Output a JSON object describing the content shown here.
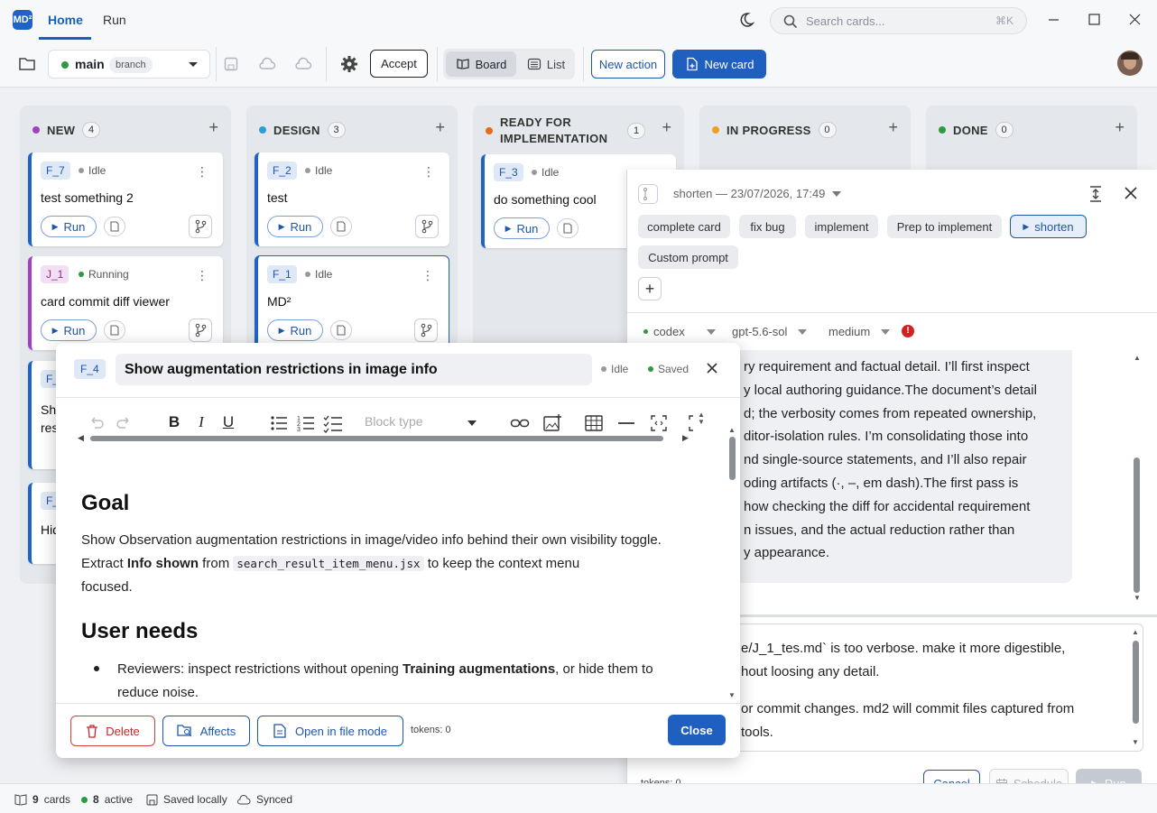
{
  "app": {
    "logo_text": "MD²",
    "tabs": [
      "Home",
      "Run"
    ],
    "active_tab": "Home",
    "search_placeholder": "Search cards...",
    "search_shortcut": "⌘K"
  },
  "toolbar": {
    "branch": "main",
    "branch_badge": "branch",
    "accept_label": "Accept",
    "board_label": "Board",
    "list_label": "List",
    "new_action_label": "New action",
    "new_card_label": "New card"
  },
  "columns": [
    {
      "title": "NEW",
      "count": "4",
      "color": "#a040c0"
    },
    {
      "title": "DESIGN",
      "count": "3",
      "color": "#2aa0d8"
    },
    {
      "title": "READY FOR IMPLEMENTATION",
      "title_line1": "READY FOR",
      "title_line2": "IMPLEMENTATION",
      "count": "1",
      "color": "#e86a1c"
    },
    {
      "title": "IN PROGRESS",
      "count": "0",
      "color": "#f0a020"
    },
    {
      "title": "DONE",
      "count": "0",
      "color": "#2e9a40"
    }
  ],
  "cards": [
    {
      "id": "F_7",
      "status": "Idle",
      "title": "test something 2",
      "run": "Run"
    },
    {
      "id": "J_1",
      "status": "Running",
      "title": "card commit diff viewer",
      "run": "Run"
    },
    {
      "id": "F_2",
      "status": "Idle",
      "title": "test",
      "run": "Run"
    },
    {
      "id": "F_1",
      "status": "Idle",
      "title": "MD²",
      "run": "Run"
    },
    {
      "id": "F_3",
      "status": "Idle",
      "title": "do something cool",
      "run": "Run"
    },
    {
      "id_partial": "F_",
      "title_partial": "Sh",
      "title_partial2": "res"
    },
    {
      "id_partial": "F_",
      "title_partial": "Hid"
    }
  ],
  "run_panel": {
    "header": "shorten — 23/07/2026, 17:49",
    "actions": [
      "complete card",
      "fix bug",
      "implement",
      "Prep to implement",
      "shorten",
      "Custom prompt"
    ],
    "model_agent": "codex",
    "model": "gpt-5.6-sol",
    "effort": "medium",
    "log_lines": [
      "ry requirement and factual detail. I’ll first inspect",
      "y local authoring guidance.The document’s detail",
      "d; the verbosity comes from repeated ownership,",
      "ditor-isolation rules. I’m consolidating those into",
      "nd single-source statements, and I’ll also repair",
      "oding artifacts (·, –, em dash).The first pass is",
      "how checking the diff for accidental requirement",
      "n issues, and the actual reduction rather than",
      "y appearance."
    ],
    "prompt_lines": [
      "e/J_1_tes.md` is too verbose. make it more digestible,",
      "hout loosing any detail.",
      "or commit changes. md2 will commit files captured from",
      "tools."
    ],
    "tokens": "tokens: 0",
    "cancel": "Cancel",
    "schedule": "Schedule",
    "run": "Run"
  },
  "editor": {
    "card_id": "F_4",
    "title": "Show augmentation restrictions in image info",
    "status": "Idle",
    "saved": "Saved",
    "block_type_placeholder": "Block type",
    "h_goal": "Goal",
    "goal_p1": "Show Observation augmentation restrictions in image/video info behind their own visibility toggle. Extract ",
    "goal_b1": "Info shown",
    "goal_p2": " from ",
    "goal_code": "search_result_item_menu.jsx",
    "goal_p3": " to keep the context menu",
    "goal_p4": "focused.",
    "h_user": "User needs",
    "li1_a": "Reviewers: inspect restrictions without opening ",
    "li1_b": "Training augmentations",
    "li1_c": ", or hide them to",
    "li1_d": "reduce noise.",
    "delete": "Delete",
    "affects": "Affects",
    "open_file": "Open in file mode",
    "tokens": "tokens: 0",
    "close": "Close"
  },
  "status_bar": {
    "cards_count": "9",
    "cards_label": "cards",
    "active_count": "8",
    "active_label": "active",
    "saved": "Saved locally",
    "synced": "Synced"
  }
}
